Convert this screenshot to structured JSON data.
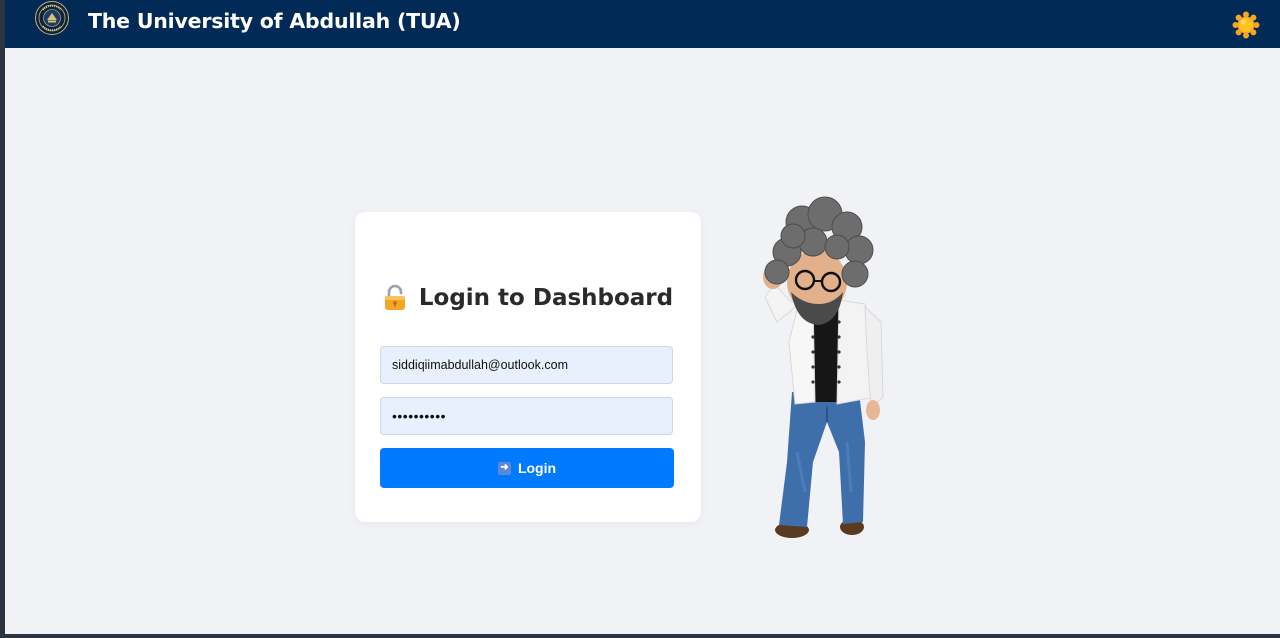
{
  "header": {
    "title": "The University of Abdullah (TUA)",
    "logo_icon": "university-seal-icon",
    "theme_toggle_icon": "sun-icon"
  },
  "login": {
    "title": "Login to Dashboard",
    "title_icon": "open-lock-icon",
    "email_value": "siddiqiimabdullah@outlook.com",
    "password_value": "••••••••••",
    "button_label": "Login",
    "button_icon": "arrow-right-icon"
  },
  "colors": {
    "navbar": "#022a57",
    "page_bg": "#f0f2f6",
    "primary": "#007bff",
    "input_bg": "#e8f0fe",
    "sun": "#f5a623"
  },
  "illustration": {
    "name": "avatar-character"
  }
}
